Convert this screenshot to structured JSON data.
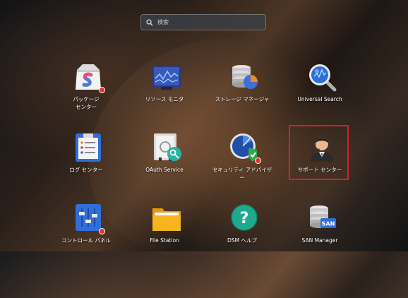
{
  "search": {
    "placeholder": "検索",
    "icon": "search-icon"
  },
  "apps": [
    {
      "label": "パッケージ\nセンター",
      "icon": "package-center-icon",
      "badge": true
    },
    {
      "label": "リソース モニタ",
      "icon": "resource-monitor-icon",
      "badge": false
    },
    {
      "label": "ストレージ マネージャ",
      "icon": "storage-manager-icon",
      "badge": false
    },
    {
      "label": "Universal Search",
      "icon": "universal-search-icon",
      "badge": false
    },
    {
      "label": "ログ センター",
      "icon": "log-center-icon",
      "badge": false
    },
    {
      "label": "OAuth Service",
      "icon": "oauth-service-icon",
      "badge": false
    },
    {
      "label": "セキュリティ アドバイザー",
      "icon": "security-advisor-icon",
      "badge": true
    },
    {
      "label": "サポート センター",
      "icon": "support-center-icon",
      "badge": false,
      "selected": true
    },
    {
      "label": "コントロール パネル",
      "icon": "control-panel-icon",
      "badge": true
    },
    {
      "label": "File Station",
      "icon": "file-station-icon",
      "badge": false
    },
    {
      "label": "DSM ヘルプ",
      "icon": "dsm-help-icon",
      "badge": false
    },
    {
      "label": "SAN Manager",
      "icon": "san-manager-icon",
      "badge": false
    }
  ],
  "san_badge_text": "SAN",
  "help_glyph": "?",
  "colors": {
    "highlight": "#d81e28",
    "badge": "#e8322c"
  }
}
